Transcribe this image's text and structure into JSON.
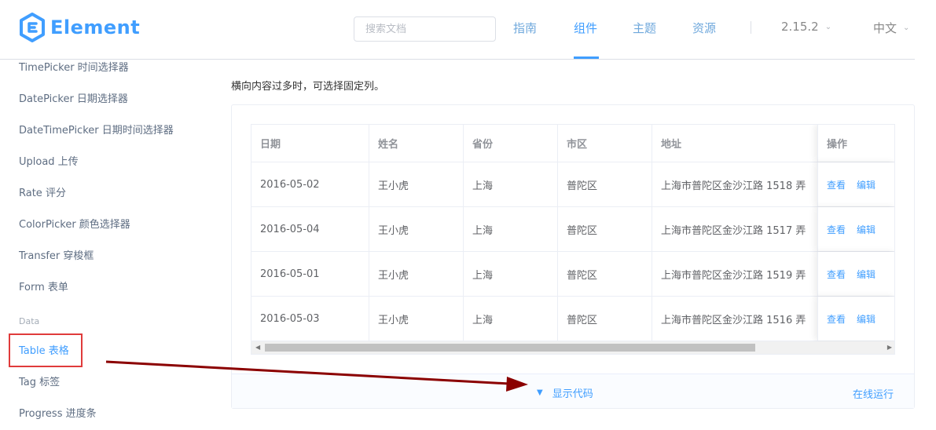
{
  "header": {
    "logo_text": "Element",
    "search_placeholder": "搜索文档",
    "nav": [
      "指南",
      "组件",
      "主题",
      "资源"
    ],
    "active_nav": "组件",
    "version": "2.15.2",
    "language": "中文"
  },
  "sidebar": {
    "items_top": [
      "TimePicker 时间选择器",
      "DatePicker 日期选择器",
      "DateTimePicker 日期时间选择器",
      "Upload 上传",
      "Rate 评分",
      "ColorPicker 颜色选择器",
      "Transfer 穿梭框",
      "Form 表单"
    ],
    "group_label": "Data",
    "items_bottom": [
      "Table 表格",
      "Tag 标签",
      "Progress 进度条"
    ],
    "active_item": "Table 表格"
  },
  "main": {
    "description": "横向内容过多时，可选择固定列。",
    "table": {
      "headers": [
        "日期",
        "姓名",
        "省份",
        "市区",
        "地址",
        "操作"
      ],
      "rows": [
        [
          "2016-05-02",
          "王小虎",
          "上海",
          "普陀区",
          "上海市普陀区金沙江路 1518 弄"
        ],
        [
          "2016-05-04",
          "王小虎",
          "上海",
          "普陀区",
          "上海市普陀区金沙江路 1517 弄"
        ],
        [
          "2016-05-01",
          "王小虎",
          "上海",
          "普陀区",
          "上海市普陀区金沙江路 1519 弄"
        ],
        [
          "2016-05-03",
          "王小虎",
          "上海",
          "普陀区",
          "上海市普陀区金沙江路 1516 弄"
        ]
      ],
      "actions": [
        "查看",
        "编辑"
      ]
    },
    "show_code": "显示代码",
    "run_online": "在线运行"
  },
  "colors": {
    "primary": "#409eff",
    "annotation_box": "#e03b3b",
    "annotation_arrow": "#8b0000"
  }
}
